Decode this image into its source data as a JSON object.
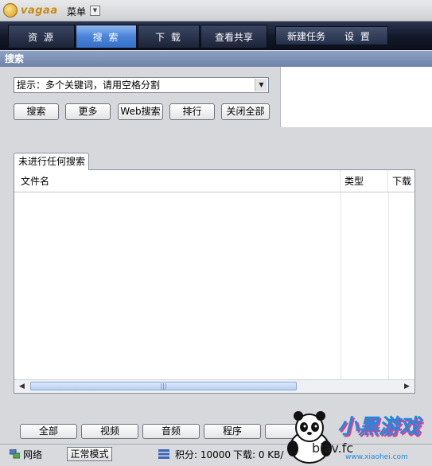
{
  "app": {
    "logo_text": "vagaa",
    "menu_label": "菜单"
  },
  "nav": {
    "tabs": [
      "资 源",
      "搜 索",
      "下 载",
      "查看共享"
    ],
    "active_tab": "搜 索",
    "actions": [
      "新建任务",
      "设 置"
    ]
  },
  "section": {
    "title": "搜索"
  },
  "search": {
    "hint": "提示：多个关键词，请用空格分割",
    "buttons": [
      "搜索",
      "更多",
      "Web搜索",
      "排行",
      "关闭全部"
    ]
  },
  "results": {
    "tab_label": "未进行任何搜索",
    "columns": [
      "文件名",
      "类型",
      "下载"
    ]
  },
  "filters": [
    "全部",
    "视频",
    "音频",
    "程序"
  ],
  "status": {
    "network": "网络",
    "mode": "正常模式",
    "points": "积分: 10000",
    "download": "下载: 0 KB/"
  },
  "watermark": {
    "url_partial": "blav.fc",
    "brand": "小黑游戏",
    "url_small": "www.xiaohei.com"
  }
}
